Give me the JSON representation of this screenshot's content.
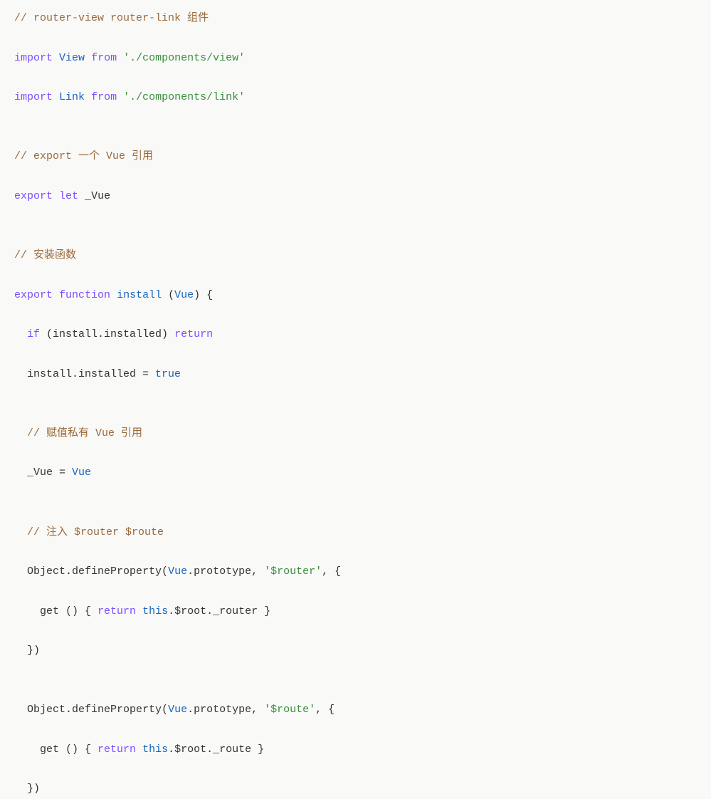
{
  "code": {
    "l1": {
      "comment": "// router-view router-link 组件"
    },
    "l2": {
      "kw": "import",
      "ident": "View",
      "from": "from",
      "str": "'./components/view'"
    },
    "l3": {
      "kw": "import",
      "ident": "Link",
      "from": "from",
      "str": "'./components/link'"
    },
    "l4": "",
    "l5": {
      "comment": "// export 一个 Vue 引用"
    },
    "l6": {
      "kw1": "export",
      "kw2": "let",
      "ident": "_Vue"
    },
    "l7": "",
    "l8": {
      "comment": "// 安装函数"
    },
    "l9": {
      "kw1": "export",
      "kw2": "function",
      "fn": "install",
      "args_open": " (",
      "arg": "Vue",
      "args_close": ") {"
    },
    "l10": {
      "indent": "  ",
      "kw": "if",
      "cond": " (install.installed) ",
      "ret": "return"
    },
    "l11": {
      "indent": "  ",
      "text1": "install.installed = ",
      "bool": "true"
    },
    "l12": "",
    "l13": {
      "indent": "  ",
      "comment": "// 赋值私有 Vue 引用"
    },
    "l14": {
      "indent": "  ",
      "lhs": "_Vue = ",
      "rhs": "Vue"
    },
    "l15": "",
    "l16": {
      "indent": "  ",
      "comment": "// 注入 $router $route"
    },
    "l17": {
      "indent": "  ",
      "t1": "Object.defineProperty(",
      "vue": "Vue",
      "t2": ".prototype, ",
      "str": "'$router'",
      "t3": ", {"
    },
    "l18": {
      "indent": "    ",
      "t1": "get () { ",
      "ret": "return",
      "sp": " ",
      "this": "this",
      "t2": ".$root._router }"
    },
    "l19": {
      "indent": "  ",
      "close": "})"
    },
    "l20": "",
    "l21": {
      "indent": "  ",
      "t1": "Object.defineProperty(",
      "vue": "Vue",
      "t2": ".prototype, ",
      "str": "'$route'",
      "t3": ", {"
    },
    "l22": {
      "indent": "    ",
      "t1": "get () { ",
      "ret": "return",
      "sp": " ",
      "this": "this",
      "t2": ".$root._route }"
    },
    "l23": {
      "indent": "  ",
      "close": "})"
    }
  }
}
